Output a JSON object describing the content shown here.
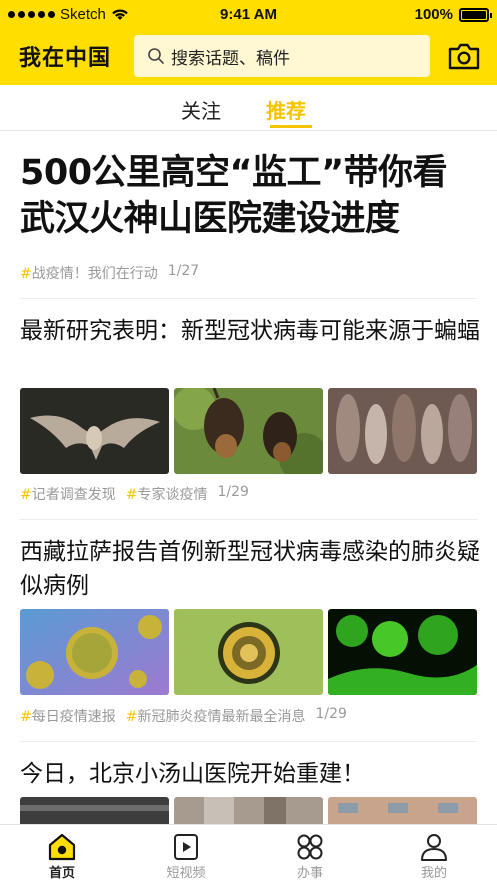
{
  "status_bar": {
    "carrier": "Sketch",
    "time": "9:41 AM",
    "battery": "100%"
  },
  "header": {
    "logo_text": "我在中国",
    "search_placeholder": "搜索话题、稿件"
  },
  "tabs": [
    {
      "label": "关注",
      "active": false
    },
    {
      "label": "推荐",
      "active": true
    }
  ],
  "feed": [
    {
      "title": "500公里高空“监工”带你看武汉火神山医院建设进度",
      "tags": [
        "战疫情！我们在行动"
      ],
      "date": "1/27",
      "images": []
    },
    {
      "title": "最新研究表明：新型冠状病毒可能来源于蝙蝠",
      "tags": [
        "记者调查发现",
        "专家谈疫情"
      ],
      "date": "1/29",
      "images": [
        "bat-in-flight-photo",
        "bats-hanging-photo",
        "bats-cluster-photo"
      ]
    },
    {
      "title": "西藏拉萨报告首例新型冠状病毒感染的肺炎疑似病例",
      "tags": [
        "每日疫情速报",
        "新冠肺炎疫情最新最全消息"
      ],
      "date": "1/29",
      "images": [
        "virus-3d-render",
        "virus-microscope-photo",
        "green-cells-photo"
      ]
    },
    {
      "title": "今日，北京小汤山医院开始重建！",
      "tags": [],
      "date": "",
      "images": [
        "hospital-interior-photo",
        "hospital-corridor-photo",
        "hospital-building-photo"
      ]
    }
  ],
  "bottom_nav": [
    {
      "label": "首页",
      "icon": "home-icon",
      "active": true
    },
    {
      "label": "短视频",
      "icon": "video-icon",
      "active": false
    },
    {
      "label": "办事",
      "icon": "services-icon",
      "active": false
    },
    {
      "label": "我的",
      "icon": "profile-icon",
      "active": false
    }
  ],
  "colors": {
    "brand_yellow": "#FFDE00",
    "accent": "#F5C400",
    "search_bg": "#FFF8D2"
  }
}
